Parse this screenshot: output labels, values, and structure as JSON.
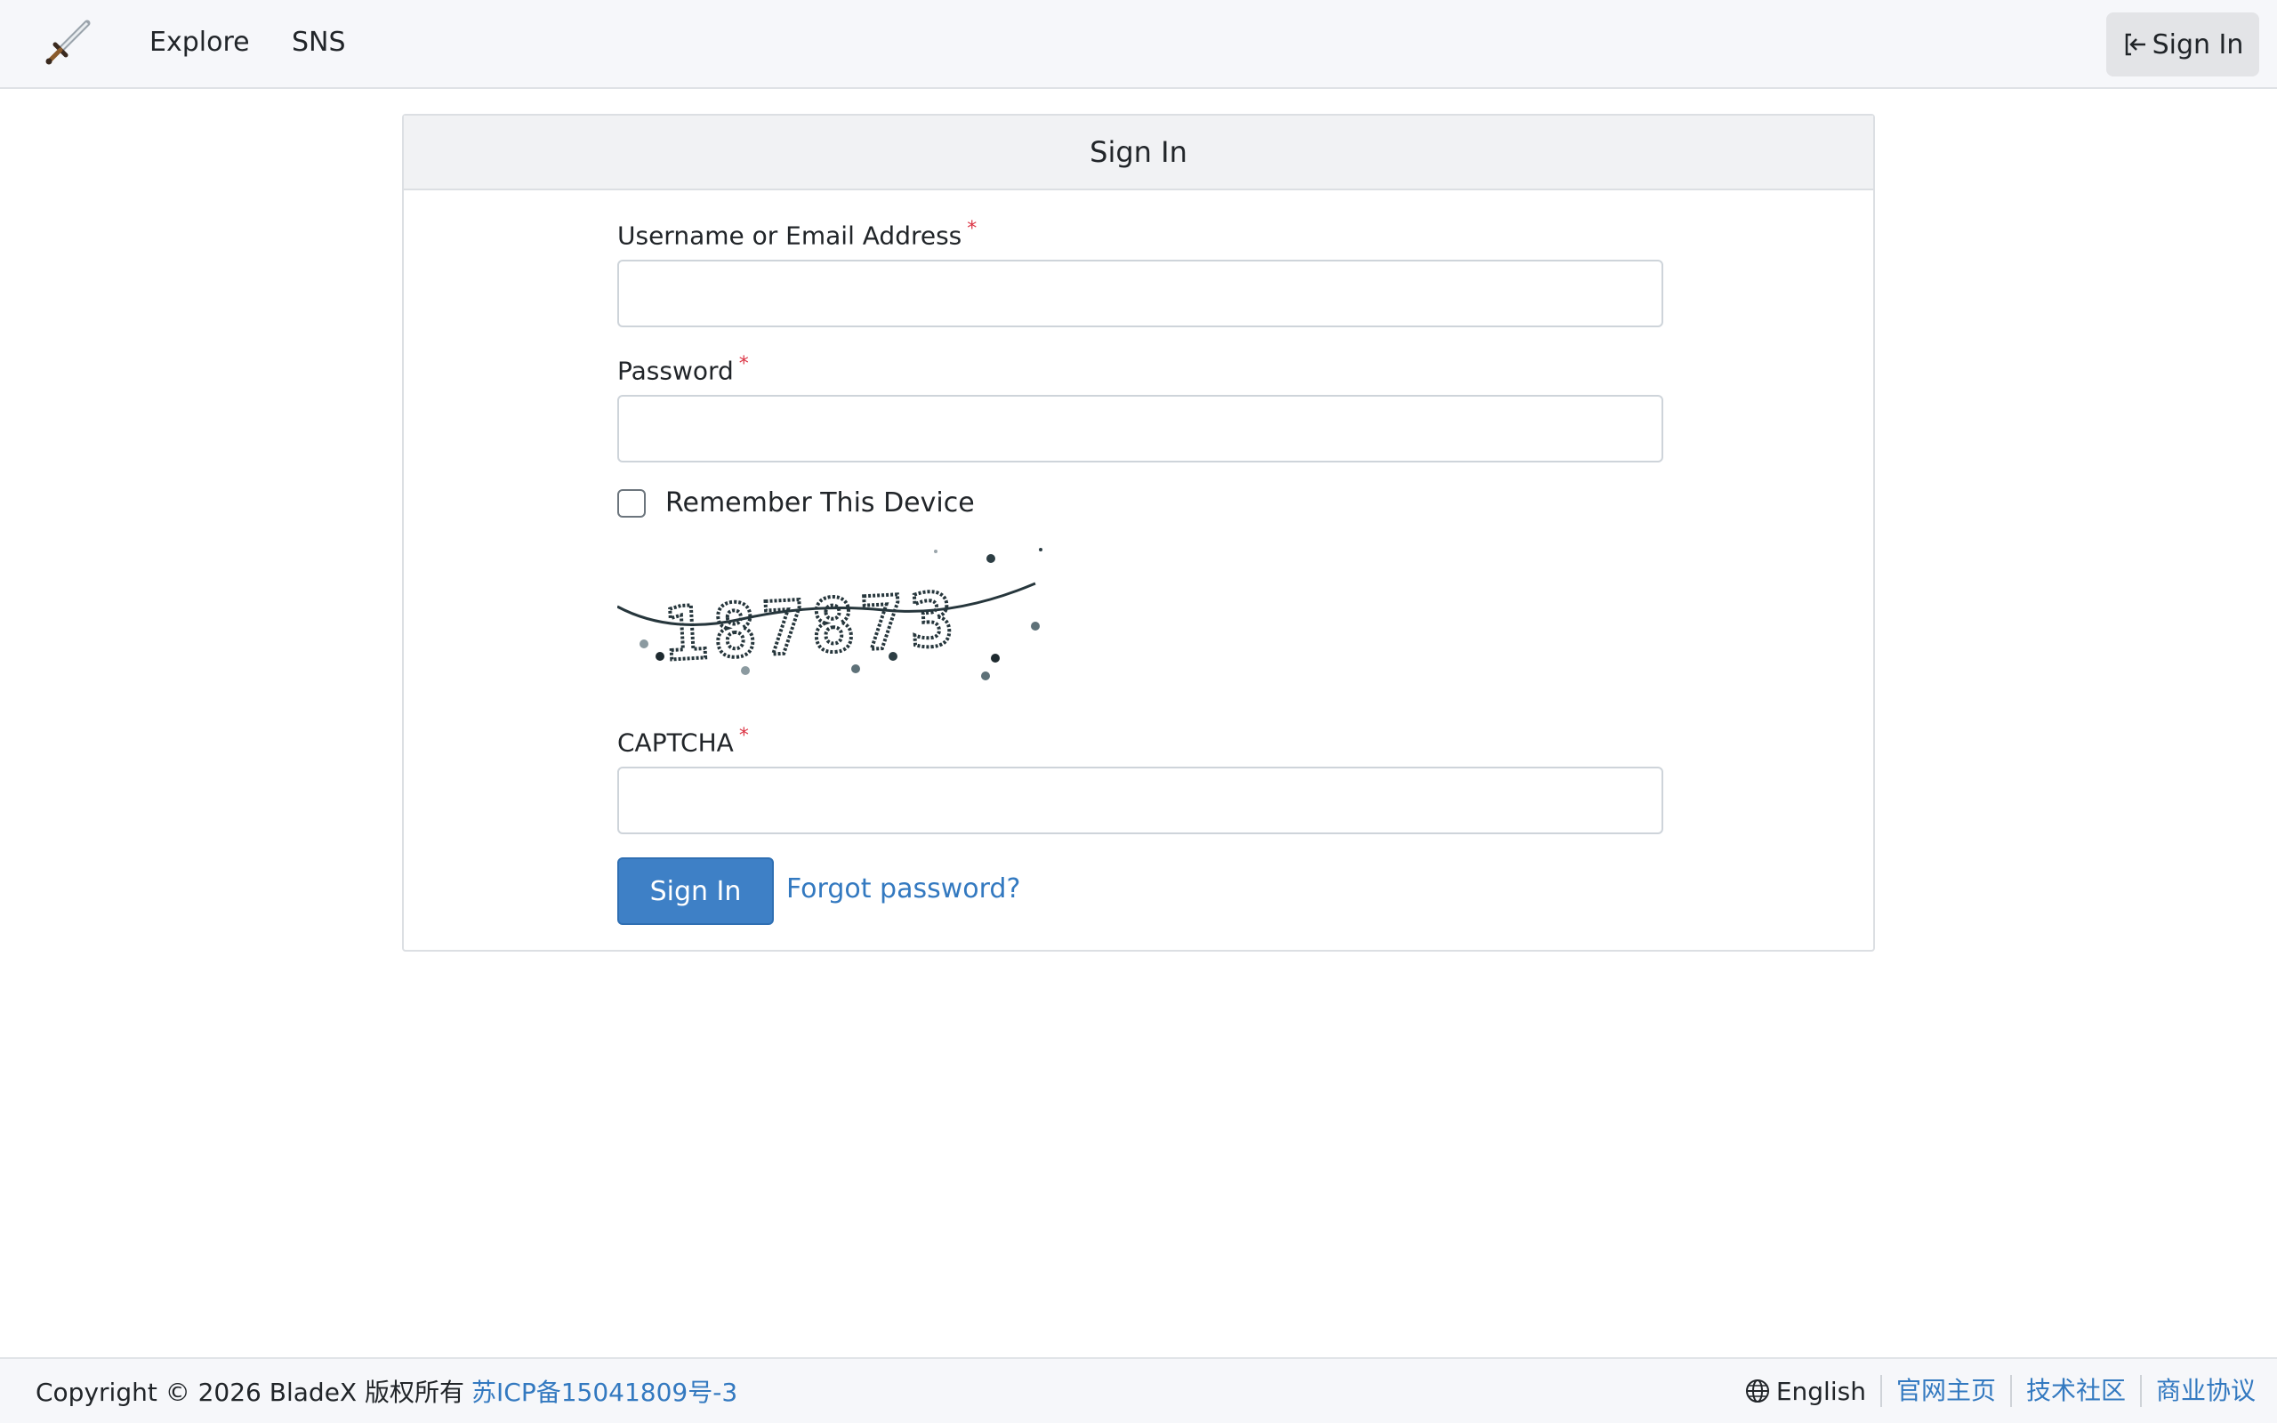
{
  "navbar": {
    "logo_icon": "sword-icon",
    "links": [
      {
        "label": "Explore"
      },
      {
        "label": "SNS"
      }
    ],
    "signin_label": "Sign In",
    "signin_icon": "sign-in-icon"
  },
  "card": {
    "title": "Sign In",
    "username": {
      "label": "Username or Email Address",
      "required_mark": "*",
      "value": ""
    },
    "password": {
      "label": "Password",
      "required_mark": "*",
      "value": ""
    },
    "remember": {
      "label": "Remember This Device",
      "checked": false
    },
    "captcha_image_text": "187873",
    "captcha": {
      "label": "CAPTCHA",
      "required_mark": "*",
      "value": ""
    },
    "submit_label": "Sign In",
    "forgot_label": "Forgot password?"
  },
  "footer": {
    "copyright": "Copyright © 2026 BladeX 版权所有",
    "icp": "苏ICP备15041809号-3",
    "language": "English",
    "links": [
      "官网主页",
      "技术社区",
      "商业协议"
    ]
  },
  "colors": {
    "primary": "#3e80c6",
    "link": "#3379c0",
    "required": "#dc3545"
  }
}
